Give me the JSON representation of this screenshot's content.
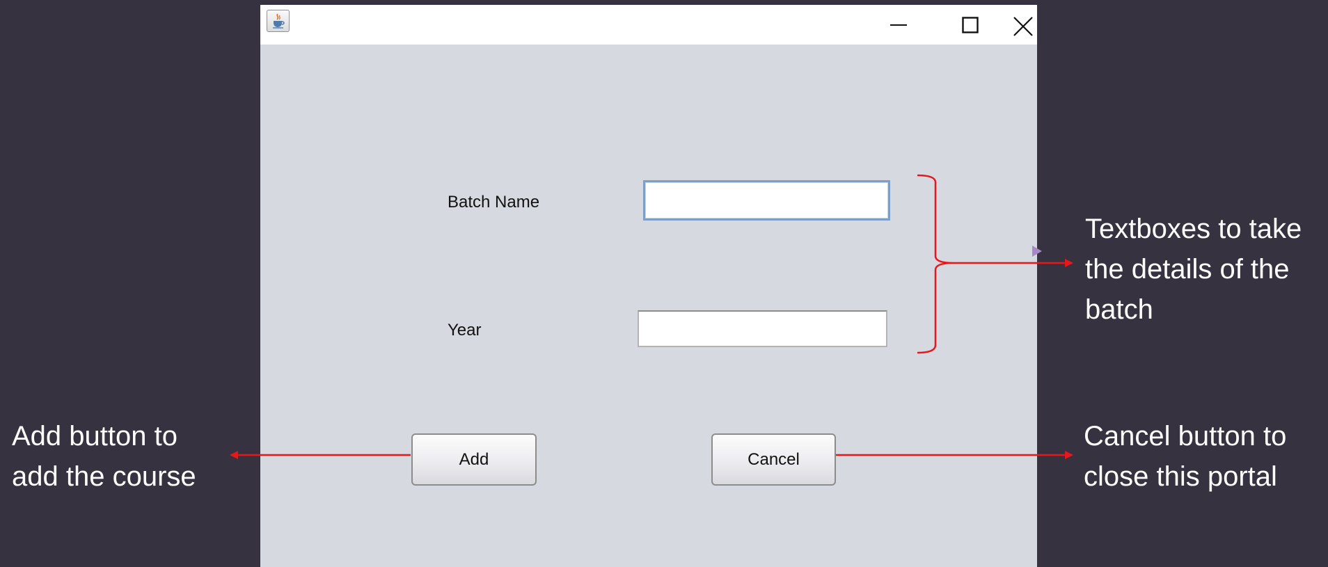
{
  "window": {
    "app_icon": "java-coffee-cup-icon",
    "controls": {
      "minimize_icon": "minimize-icon",
      "maximize_icon": "maximize-icon",
      "close_icon": "close-icon"
    }
  },
  "form": {
    "batch_name_label": "Batch Name",
    "batch_name_value": "",
    "year_label": "Year",
    "year_value": "",
    "add_label": "Add",
    "cancel_label": "Cancel"
  },
  "annotations": {
    "textboxes_note": "Textboxes to take\nthe details of the\nbatch",
    "add_note": "Add button to\nadd the course",
    "cancel_note": "Cancel button to\nclose this portal",
    "arrow_color": "#e8171c"
  },
  "colors": {
    "background": "#36323f",
    "window_body": "#d6d9e0",
    "titlebar": "#ffffff",
    "focus_border": "#7d9ec5"
  }
}
